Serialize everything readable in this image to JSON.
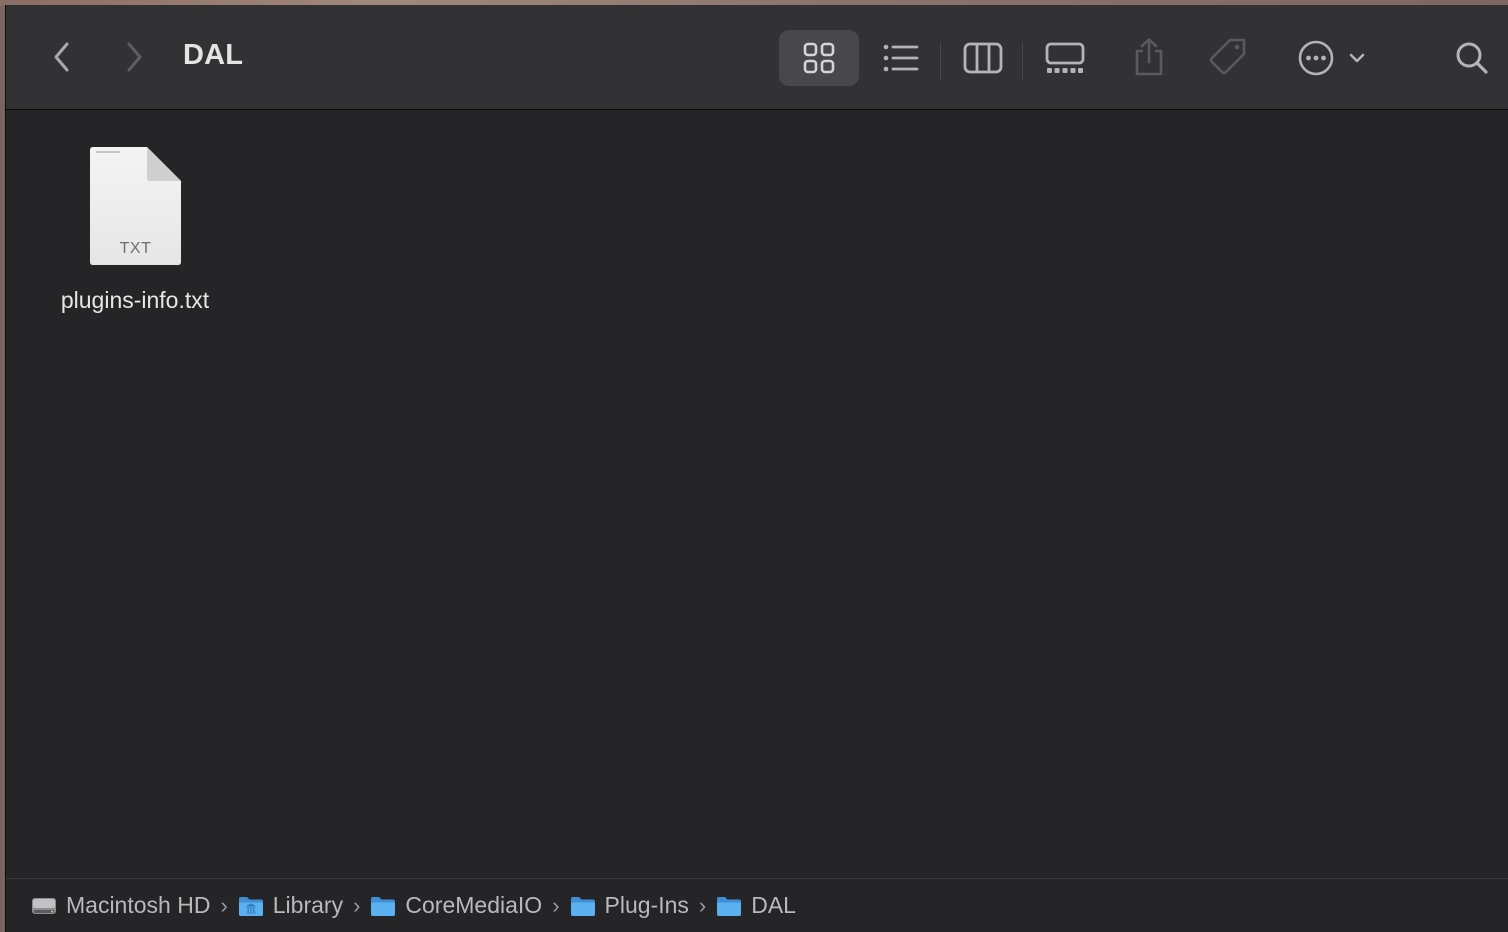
{
  "window": {
    "title": "DAL"
  },
  "toolbar": {
    "icons": [
      "chevron-left-icon",
      "chevron-right-icon",
      "grid-view-icon",
      "list-view-icon",
      "column-view-icon",
      "gallery-view-icon",
      "share-icon",
      "tag-icon",
      "more-actions-icon",
      "chevron-down-icon",
      "search-icon"
    ],
    "selected_view": "icon"
  },
  "files": [
    {
      "name": "plugins-info.txt",
      "type_label": "TXT",
      "icon": "text-document-icon"
    }
  ],
  "path_bar": {
    "items": [
      {
        "label": "Macintosh HD",
        "icon": "hard-drive-icon"
      },
      {
        "label": "Library",
        "icon": "library-folder-icon"
      },
      {
        "label": "CoreMediaIO",
        "icon": "folder-icon"
      },
      {
        "label": "Plug-Ins",
        "icon": "folder-icon"
      },
      {
        "label": "DAL",
        "icon": "folder-icon"
      }
    ],
    "separator": "›"
  },
  "colors": {
    "window_bg": "#252527",
    "toolbar_bg": "#323234",
    "folder_blue": "#4aa3e8",
    "text_primary": "#e7e7e7",
    "text_secondary": "#b9b9bb"
  }
}
